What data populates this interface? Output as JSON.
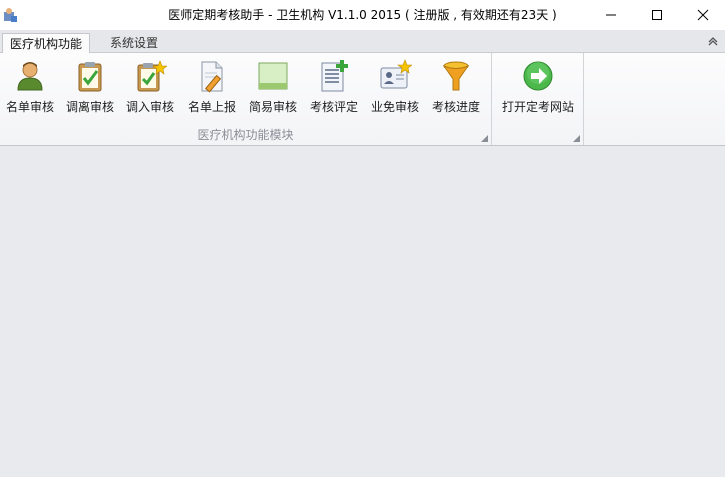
{
  "window": {
    "title": "医师定期考核助手 - 卫生机构 V1.1.0 2015 ( 注册版 , 有效期还有23天 )"
  },
  "tabs": [
    {
      "label": "医疗机构功能",
      "active": true
    },
    {
      "label": "系统设置",
      "active": false
    }
  ],
  "ribbon": {
    "group1": {
      "label": "医疗机构功能模块",
      "buttons": [
        {
          "label": "名单审核",
          "icon": "person-icon"
        },
        {
          "label": "调离审核",
          "icon": "clipboard-check-icon"
        },
        {
          "label": "调入审核",
          "icon": "clipboard-star-icon"
        },
        {
          "label": "名单上报",
          "icon": "document-pencil-icon"
        },
        {
          "label": "简易审核",
          "icon": "green-box-icon"
        },
        {
          "label": "考核评定",
          "icon": "document-add-icon"
        },
        {
          "label": "业免审核",
          "icon": "id-card-star-icon"
        },
        {
          "label": "考核进度",
          "icon": "funnel-icon"
        }
      ]
    },
    "group2": {
      "label": "",
      "buttons": [
        {
          "label": "打开定考网站",
          "icon": "green-arrow-icon"
        }
      ]
    }
  },
  "colors": {
    "accent_green": "#3aa53a",
    "workspace_bg": "#e9eaee"
  }
}
